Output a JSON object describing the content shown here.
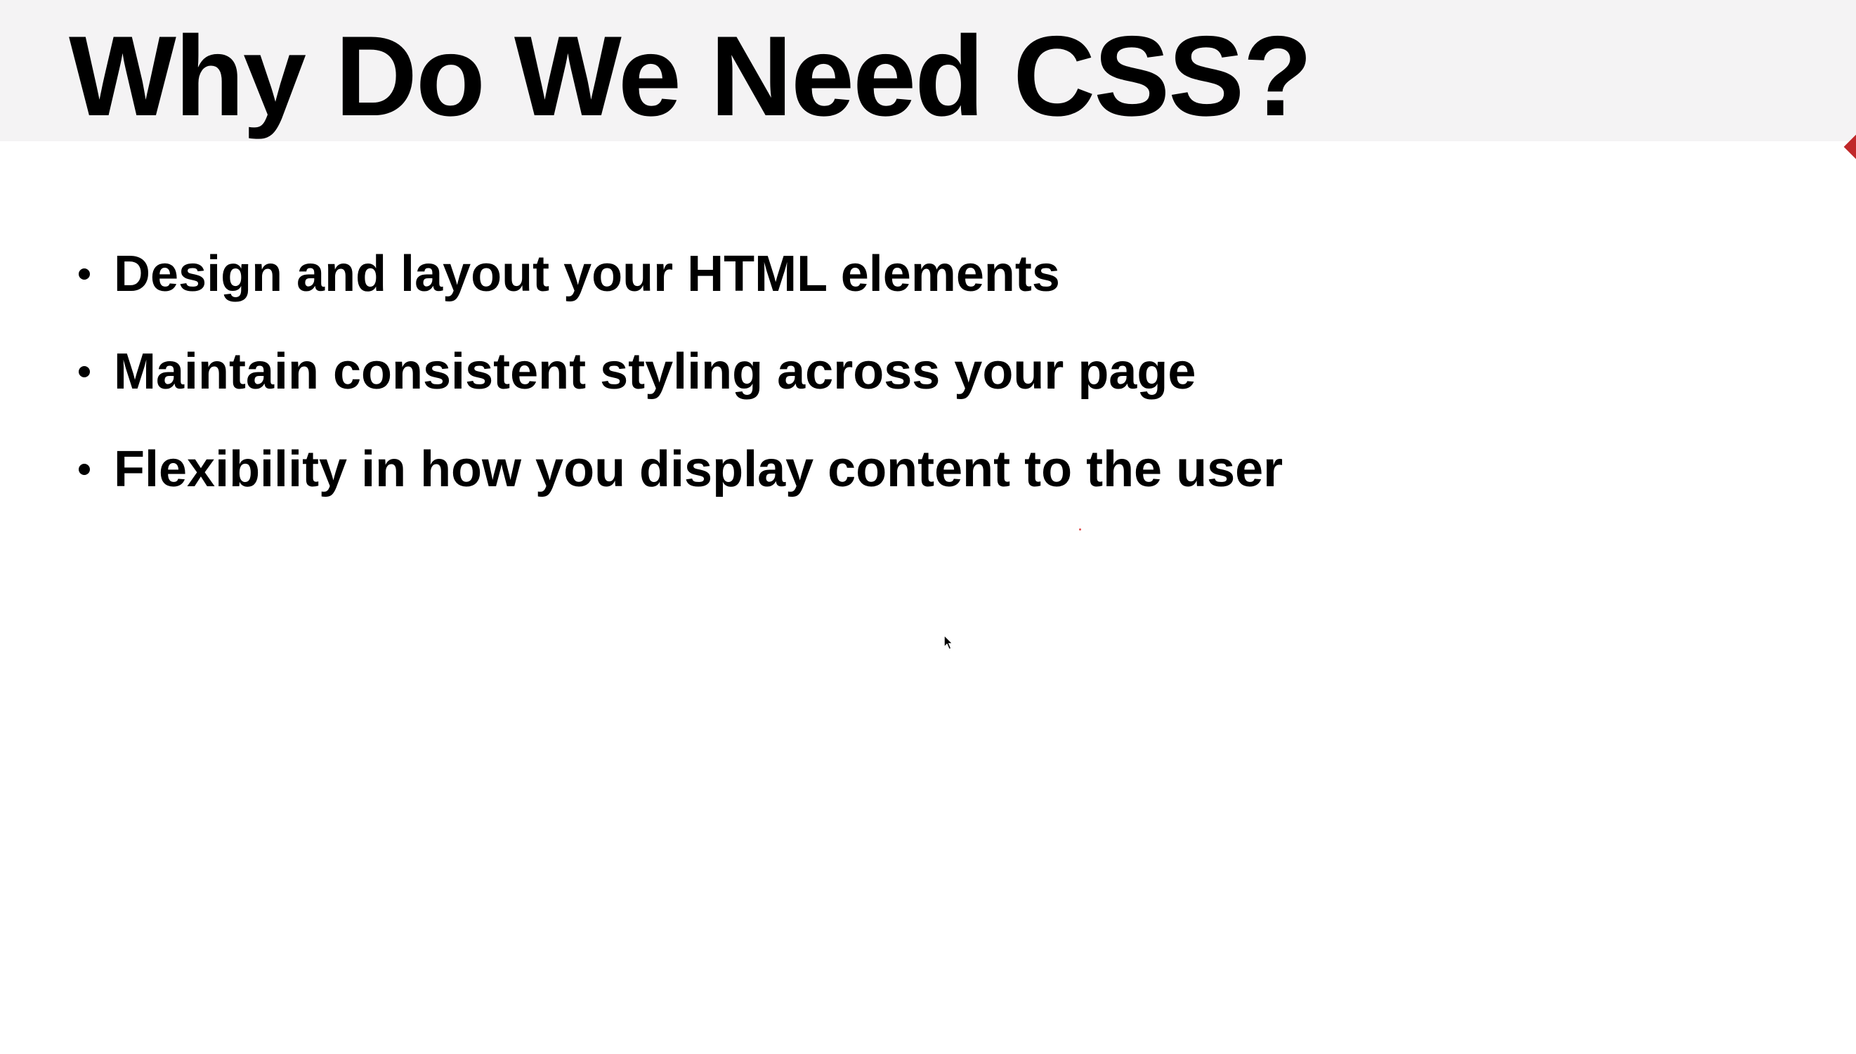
{
  "slide": {
    "title": "Why Do We Need CSS?",
    "bullets": [
      "Design and layout your HTML elements",
      "Maintain consistent styling across your page",
      "Flexibility in how you display content to the user"
    ]
  },
  "colors": {
    "title_band": "#f4f3f4",
    "text": "#000000",
    "marker": "#c0282a"
  },
  "icons": {
    "cursor": "mouse-pointer-icon"
  }
}
